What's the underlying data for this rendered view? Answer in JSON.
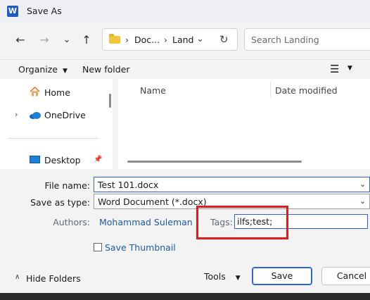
{
  "window": {
    "title": "Save As",
    "app_icon": "W"
  },
  "nav": {
    "back": "←",
    "forward": "→",
    "recent": "⌄",
    "up": "↑"
  },
  "address": {
    "crumbs": [
      "Doc...",
      "Land"
    ],
    "sep": "›",
    "refresh": "↻",
    "dropdown": "⌄"
  },
  "search": {
    "placeholder": "Search Landing"
  },
  "toolbar": {
    "organize": "Organize",
    "new_folder": "New folder",
    "view_icon": "☰"
  },
  "sidebar": {
    "items": [
      {
        "label": "Home"
      },
      {
        "label": "OneDrive"
      },
      {
        "label": "Desktop"
      }
    ]
  },
  "columns": {
    "name": "Name",
    "date_modified": "Date modified"
  },
  "form": {
    "file_name_label": "File name:",
    "file_name_value": "Test 101.docx",
    "save_type_label": "Save as type:",
    "save_type_value": "Word Document (*.docx)",
    "authors_label": "Authors:",
    "authors_value": "Mohammad Suleman",
    "tags_label": "Tags:",
    "tags_value": "ilfs;test;",
    "thumbnail_label": "Save Thumbnail"
  },
  "footer": {
    "hide_folders": "Hide Folders",
    "tools": "Tools",
    "save": "Save",
    "cancel": "Cancel"
  },
  "colors": {
    "accent": "#2b65d9",
    "highlight_box": "#e01b1b"
  }
}
